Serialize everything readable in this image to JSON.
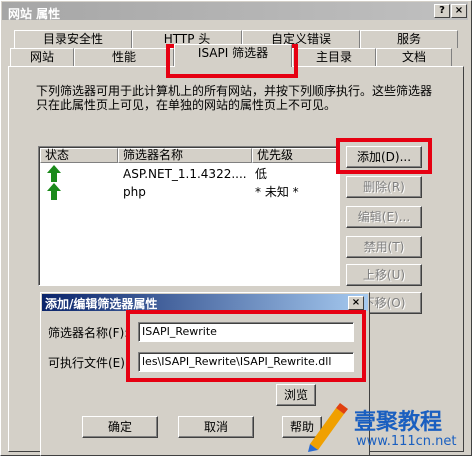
{
  "window": {
    "title": "网站 属性",
    "help_glyph": "?",
    "close_glyph": "×"
  },
  "tabs": {
    "row1": [
      "目录安全性",
      "HTTP 头",
      "自定义错误",
      "服务"
    ],
    "row2": [
      "网站",
      "性能",
      "ISAPI 筛选器",
      "主目录",
      "文档"
    ]
  },
  "panel": {
    "description": "下列筛选器可用于此计算机上的所有网站，并按下列顺序执行。这些筛选器只在此属性页上可见，在单独的网站的属性页上不可见。"
  },
  "list": {
    "columns": [
      "状态",
      "筛选器名称",
      "优先级"
    ],
    "rows": [
      {
        "status_icon": "up-arrow-green",
        "name": "ASP.NET_1.1.4322....",
        "priority": "低"
      },
      {
        "status_icon": "up-arrow-green",
        "name": "php",
        "priority": "* 未知 *"
      }
    ]
  },
  "buttons": {
    "add": "添加(D)...",
    "remove": "删除(R)",
    "edit": "编辑(E)...",
    "disable": "禁用(T)",
    "move_up": "上移(U)",
    "move_down": "下移(O)"
  },
  "dialog": {
    "title": "添加/编辑筛选器属性",
    "close_glyph": "×",
    "name_label": "筛选器名称(F):",
    "name_value": "ISAPI_Rewrite",
    "exe_label": "可执行文件(E):",
    "exe_value": "les\\ISAPI_Rewrite\\ISAPI_Rewrite.dll",
    "browse": "浏览",
    "ok": "确定",
    "cancel": "取消",
    "help": "帮助"
  },
  "watermark": {
    "brand": "壹聚教程",
    "url": "www.111cn.net"
  },
  "colors": {
    "highlight": "#e60012",
    "status_icon": "#1a8a1a",
    "dialog_title": "#0a246a"
  }
}
